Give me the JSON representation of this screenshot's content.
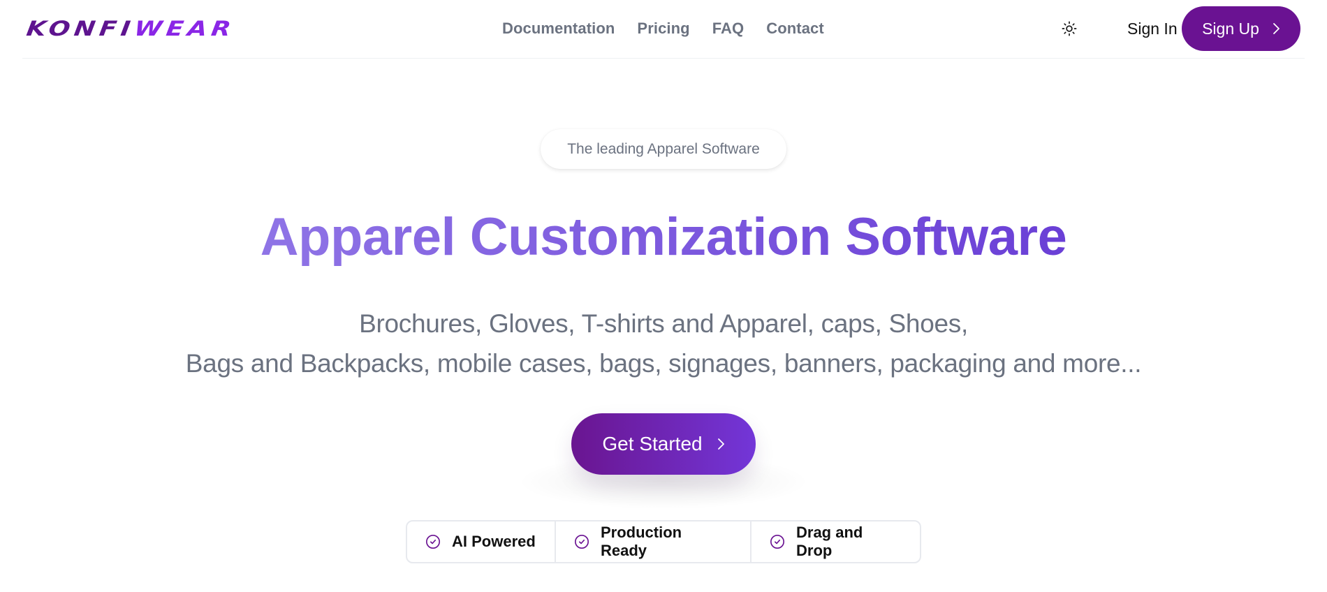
{
  "header": {
    "logo": {
      "part1": "KONFI",
      "part2": "WEAR"
    },
    "nav": [
      {
        "label": "Documentation"
      },
      {
        "label": "Pricing"
      },
      {
        "label": "FAQ"
      },
      {
        "label": "Contact"
      }
    ],
    "theme_toggle_icon": "sun-icon",
    "sign_in_label": "Sign In",
    "sign_up_label": "Sign Up",
    "sign_up_icon": "chevron-right-icon"
  },
  "hero": {
    "badge": "The leading Apparel Software",
    "title": "Apparel Customization Software",
    "subtitle_line1": "Brochures, Gloves, T-shirts and Apparel, caps, Shoes,",
    "subtitle_line2": "Bags and Backpacks, mobile cases, bags, signages, banners, packaging and more...",
    "cta_label": "Get Started",
    "cta_icon": "chevron-right-icon"
  },
  "features": [
    {
      "label": "AI Powered",
      "icon": "check-circle-icon"
    },
    {
      "label": "Production Ready",
      "icon": "check-circle-icon"
    },
    {
      "label": "Drag and Drop",
      "icon": "check-circle-icon"
    }
  ],
  "colors": {
    "brand_dark": "#5e148f",
    "brand_light": "#8a26e6",
    "sign_up_bg": "#6a1292",
    "title_gradient_start": "#8f74e6",
    "title_gradient_end": "#6a3fd6",
    "cta_gradient_start": "#6a1590",
    "cta_gradient_end": "#7336d8",
    "muted_text": "#6b7280"
  }
}
